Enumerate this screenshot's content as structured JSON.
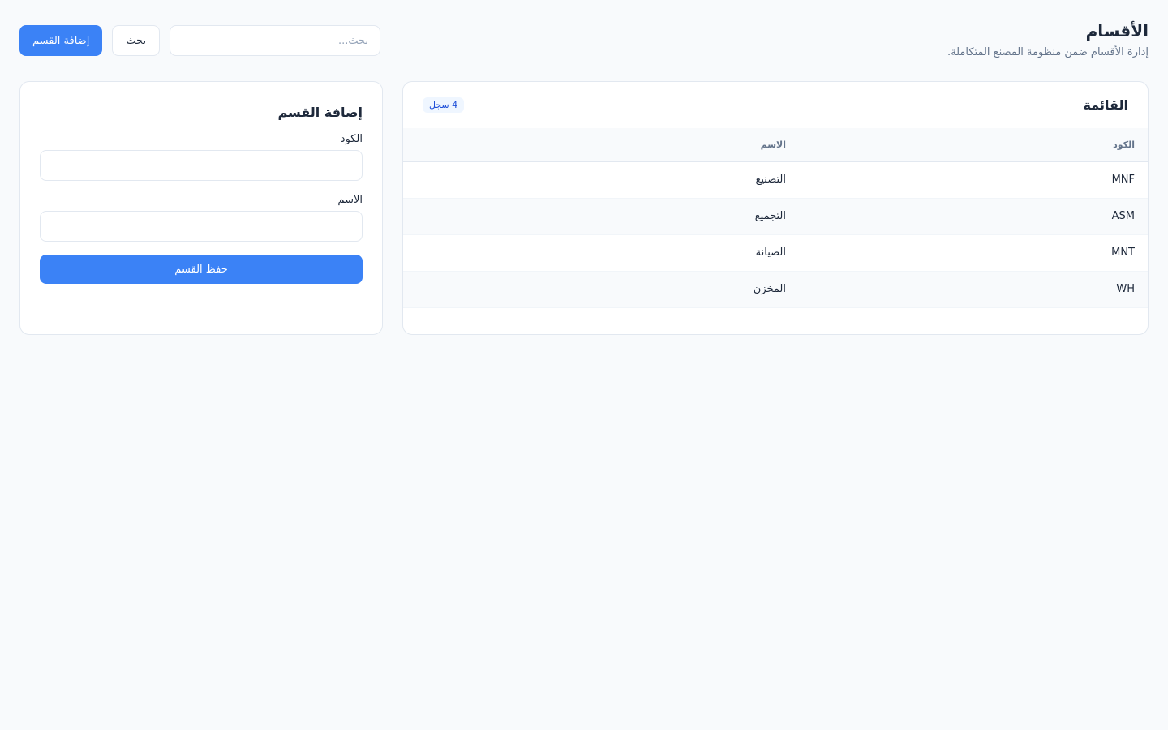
{
  "header": {
    "title": "الأقسام",
    "subtitle": "إدارة الأقسام ضمن منظومة المصنع المتكاملة."
  },
  "toolbar": {
    "search_placeholder": "بحث...",
    "search_button": "بحث",
    "add_button": "إضافة القسم"
  },
  "list": {
    "title": "القائمة",
    "count_badge": "4 سجل",
    "columns": {
      "code": "الكود",
      "name": "الاسم"
    },
    "rows": [
      {
        "code": "MNF",
        "name": "التصنيع"
      },
      {
        "code": "ASM",
        "name": "التجميع"
      },
      {
        "code": "MNT",
        "name": "الصيانة"
      },
      {
        "code": "WH",
        "name": "المخزن"
      }
    ]
  },
  "form": {
    "title": "إضافة القسم",
    "code_label": "الكود",
    "code_value": "",
    "name_label": "الاسم",
    "name_value": "",
    "save_button": "حفظ القسم"
  },
  "colors": {
    "primary": "#3b82f6",
    "background": "#f8fafc",
    "border": "#e2e8f0"
  }
}
